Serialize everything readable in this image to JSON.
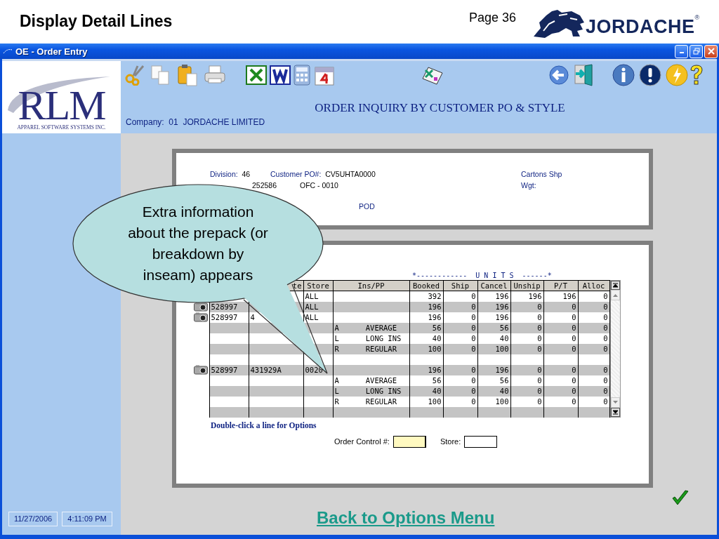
{
  "slide": {
    "title": "Display Detail Lines",
    "page": "Page 36",
    "brand": {
      "name": "JORDACHE",
      "mark": "®"
    }
  },
  "window": {
    "title": "OE - Order Entry"
  },
  "logo": {
    "name": "RLM",
    "tagline": "APPAREL SOFTWARE SYSTEMS INC."
  },
  "screen_title": "ORDER INQUIRY BY CUSTOMER PO & STYLE",
  "company": "Company:  01  JORDACHE LIMITED",
  "order_header": {
    "rows": [
      [
        {
          "label": "Division:",
          "value": "46"
        },
        {
          "label": "Customer PO#:",
          "value": "CV5UHTA0000"
        },
        {
          "label": "Cartons Shp"
        }
      ],
      [
        {
          "value": "252586"
        },
        {
          "value": "OFC - 0010"
        },
        {
          "label": "Wgt:"
        }
      ]
    ],
    "pod": "POD"
  },
  "units_caption": "*------------  U N I T S  ------*",
  "table": {
    "columns": [
      {},
      {
        "label": "te"
      },
      {
        "label": "Store"
      },
      {
        "label": "Ins/PP"
      },
      {
        "label": "Booked"
      },
      {
        "label": "Ship"
      },
      {
        "label": "Cancel"
      },
      {
        "label": "Unship"
      },
      {
        "label": "P/T"
      },
      {
        "label": "Alloc"
      }
    ],
    "rows": [
      {
        "camera": false,
        "cells": [
          null,
          null,
          "ALL",
          null,
          "392",
          "0",
          "196",
          "196",
          "196",
          "0"
        ]
      },
      {
        "camera": true,
        "cells": [
          "528997",
          null,
          "ALL",
          null,
          "196",
          "0",
          "196",
          "0",
          "0",
          "0"
        ]
      },
      {
        "camera": true,
        "cells": [
          "528997",
          "4",
          "ALL",
          null,
          "196",
          "0",
          "196",
          "0",
          "0",
          "0"
        ]
      },
      {
        "camera": false,
        "cells": [
          null,
          null,
          null,
          "A      AVERAGE",
          "56",
          "0",
          "56",
          "0",
          "0",
          "0"
        ]
      },
      {
        "camera": false,
        "cells": [
          null,
          null,
          null,
          "L      LONG INS",
          "40",
          "0",
          "40",
          "0",
          "0",
          "0"
        ]
      },
      {
        "camera": false,
        "cells": [
          null,
          null,
          null,
          "R      REGULAR",
          "100",
          "0",
          "100",
          "0",
          "0",
          "0"
        ]
      },
      {
        "camera": false,
        "cells": [
          null,
          null,
          null,
          null,
          null,
          null,
          null,
          null,
          null,
          null
        ]
      },
      {
        "camera": true,
        "cells": [
          "528997",
          "431929A",
          "0020",
          null,
          "196",
          "0",
          "196",
          "0",
          "0",
          "0"
        ]
      },
      {
        "camera": false,
        "cells": [
          null,
          null,
          null,
          "A      AVERAGE",
          "56",
          "0",
          "56",
          "0",
          "0",
          "0"
        ]
      },
      {
        "camera": false,
        "cells": [
          null,
          null,
          null,
          "L      LONG INS",
          "40",
          "0",
          "40",
          "0",
          "0",
          "0"
        ]
      },
      {
        "camera": false,
        "cells": [
          null,
          null,
          null,
          "R      REGULAR",
          "100",
          "0",
          "100",
          "0",
          "0",
          "0"
        ]
      },
      {
        "camera": false,
        "cells": [
          null,
          null,
          null,
          null,
          null,
          null,
          null,
          null,
          null,
          null
        ]
      }
    ]
  },
  "hint": "Double-click a line for Options",
  "order_control": {
    "label": "Order Control #:",
    "focused": true
  },
  "store_field": {
    "label": "Store:",
    "focused": false
  },
  "sidebar": {
    "date": "11/27/2006",
    "time": "4:11:09 PM"
  },
  "back_link": "Back to Options Menu",
  "callout": "Extra information\nabout the prepack (or\nbreakdown by\ninseam) appears"
}
